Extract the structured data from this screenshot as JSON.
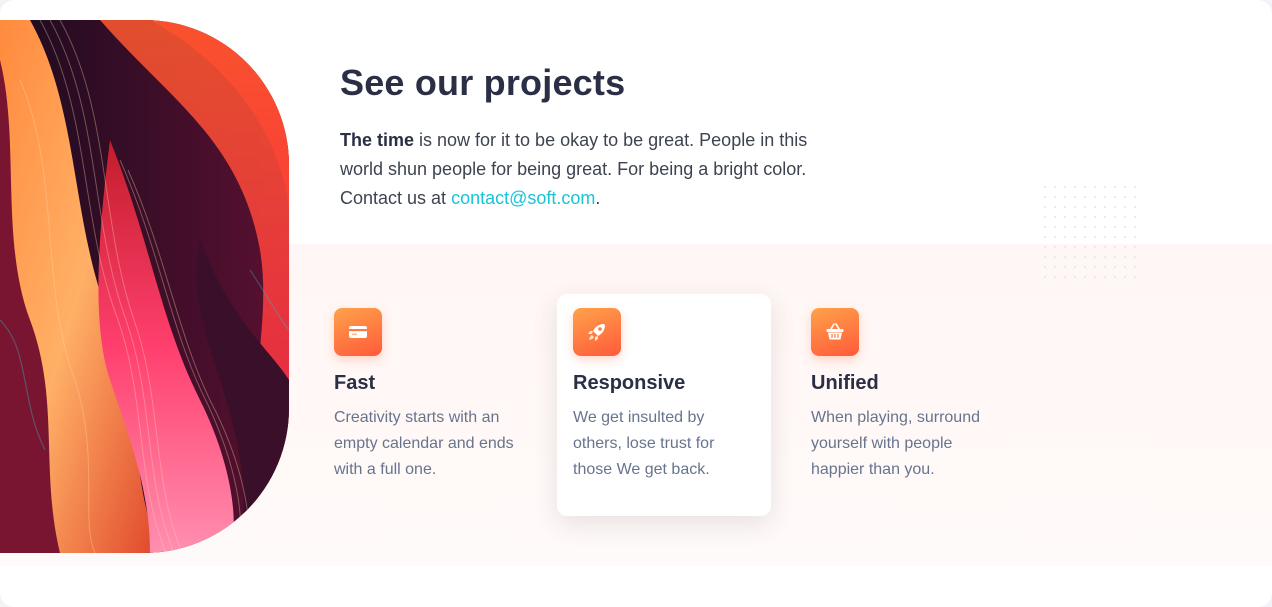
{
  "section": {
    "title": "See our projects",
    "lead_strong": "The time",
    "lead_text": " is now for it to be okay to be great. People in this world shun people for being great. For being a bright color. Contact us at ",
    "contact_email": "contact@soft.com",
    "lead_end": "."
  },
  "features": [
    {
      "title": "Fast",
      "text": "Creativity starts with an empty calendar and ends with a full one.",
      "icon": "credit-card-icon"
    },
    {
      "title": "Responsive",
      "text": "We get insulted by others, lose trust for those We get back.",
      "icon": "rocket-icon"
    },
    {
      "title": "Unified",
      "text": "When playing, surround yourself with people happier than you.",
      "icon": "basket-icon"
    }
  ],
  "colors": {
    "accent_gradient_start": "#ffa24a",
    "accent_gradient_end": "#ff5a3a",
    "link": "#1ac3d6",
    "heading": "#2a2f45",
    "body_text": "#67748e",
    "band_background": "#fff8f6"
  }
}
